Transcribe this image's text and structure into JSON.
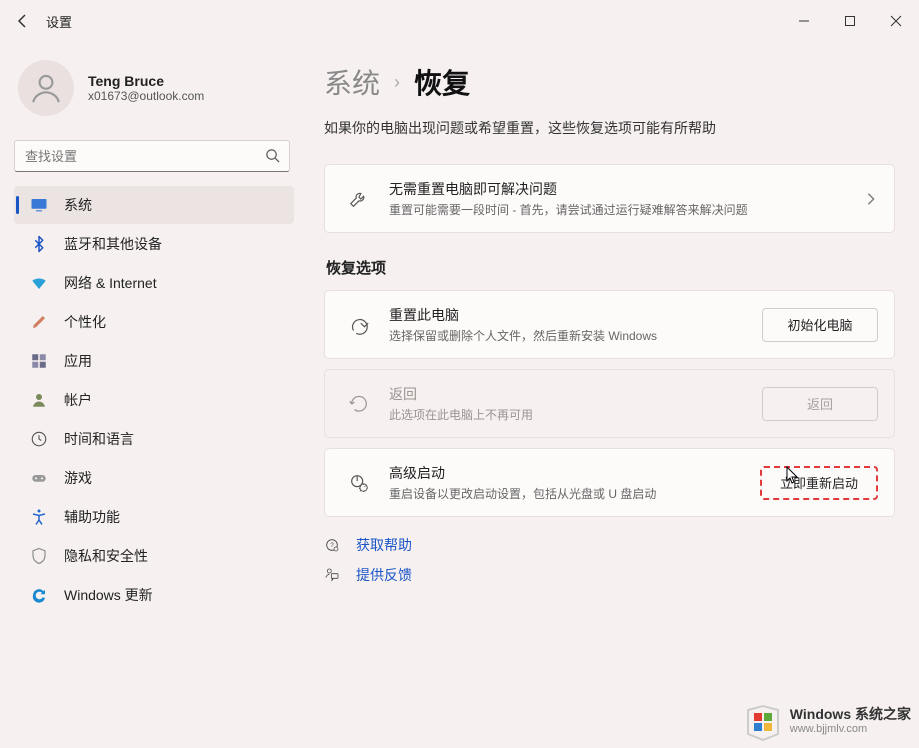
{
  "window": {
    "title": "设置"
  },
  "account": {
    "name": "Teng Bruce",
    "email": "x01673@outlook.com"
  },
  "search": {
    "placeholder": "查找设置"
  },
  "nav": [
    {
      "label": "系统",
      "icon": "display-icon",
      "active": true,
      "color": "#3a7ad6"
    },
    {
      "label": "蓝牙和其他设备",
      "icon": "bluetooth-icon",
      "color": "#1a55c6"
    },
    {
      "label": "网络 & Internet",
      "icon": "wifi-icon",
      "color": "#2aa0d8"
    },
    {
      "label": "个性化",
      "icon": "brush-icon",
      "color": "#d08060"
    },
    {
      "label": "应用",
      "icon": "apps-icon",
      "color": "#6b6b8a"
    },
    {
      "label": "帐户",
      "icon": "person-icon",
      "color": "#7a8a5a"
    },
    {
      "label": "时间和语言",
      "icon": "clock-lang-icon",
      "color": "#555"
    },
    {
      "label": "游戏",
      "icon": "gamepad-icon",
      "color": "#888"
    },
    {
      "label": "辅助功能",
      "icon": "accessibility-icon",
      "color": "#2366cc"
    },
    {
      "label": "隐私和安全性",
      "icon": "shield-icon",
      "color": "#888"
    },
    {
      "label": "Windows 更新",
      "icon": "update-icon",
      "color": "#1a8ad0"
    }
  ],
  "breadcrumb": {
    "parent": "系统",
    "current": "恢复"
  },
  "intro": "如果你的电脑出现问题或希望重置，这些恢复选项可能有所帮助",
  "troubleshoot_card": {
    "title": "无需重置电脑即可解决问题",
    "subtitle": "重置可能需要一段时间 - 首先，请尝试通过运行疑难解答来解决问题"
  },
  "recovery_section_title": "恢复选项",
  "reset_card": {
    "title": "重置此电脑",
    "subtitle": "选择保留或删除个人文件，然后重新安装 Windows",
    "button": "初始化电脑"
  },
  "goback_card": {
    "title": "返回",
    "subtitle": "此选项在此电脑上不再可用",
    "button": "返回"
  },
  "advanced_card": {
    "title": "高级启动",
    "subtitle": "重启设备以更改启动设置，包括从光盘或 U 盘启动",
    "button": "立即重新启动"
  },
  "links": {
    "help": "获取帮助",
    "feedback": "提供反馈"
  },
  "watermark": {
    "brand_en": "Windows",
    "brand_cn": "系统之家",
    "url": "www.bjjmlv.com"
  }
}
